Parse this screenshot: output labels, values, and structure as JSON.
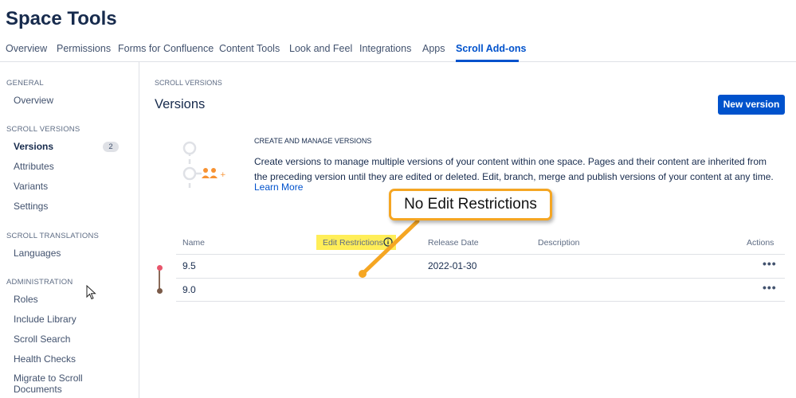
{
  "header": {
    "title": "Space Tools"
  },
  "tabs": [
    {
      "label": "Overview"
    },
    {
      "label": "Permissions"
    },
    {
      "label": "Forms for Confluence"
    },
    {
      "label": "Content Tools"
    },
    {
      "label": "Look and Feel"
    },
    {
      "label": "Integrations"
    },
    {
      "label": "Apps"
    },
    {
      "label": "Scroll Add-ons"
    }
  ],
  "sidebar": {
    "general_heading": "GENERAL",
    "overview": "Overview",
    "scroll_versions_heading": "SCROLL VERSIONS",
    "versions": "Versions",
    "versions_count": "2",
    "attributes": "Attributes",
    "variants": "Variants",
    "settings": "Settings",
    "scroll_translations_heading": "SCROLL TRANSLATIONS",
    "languages": "Languages",
    "administration_heading": "ADMINISTRATION",
    "roles": "Roles",
    "include_library": "Include Library",
    "scroll_search": "Scroll Search",
    "health_checks": "Health Checks",
    "migrate": "Migrate to Scroll Documents"
  },
  "main": {
    "breadcrumb": "SCROLL VERSIONS",
    "title": "Versions",
    "new_version_label": "New version",
    "info_heading": "CREATE AND MANAGE VERSIONS",
    "info_text": "Create versions to manage multiple versions of your content within one space. Pages and their content are inherited from the preceding version until they are edited or deleted. Edit, branch, merge and publish versions of your content at any time.",
    "learn_more": "Learn More"
  },
  "table": {
    "columns": {
      "name": "Name",
      "edit_restrictions": "Edit Restrictions",
      "release_date": "Release Date",
      "description": "Description",
      "actions": "Actions"
    },
    "rows": [
      {
        "name": "9.5",
        "release_date": "2022-01-30",
        "actions": "•••"
      },
      {
        "name": "9.0",
        "release_date": "",
        "actions": "•••"
      }
    ]
  },
  "annotation": {
    "callout_text": "No Edit Restrictions"
  },
  "colors": {
    "accent": "#0052cc",
    "highlight": "#ffee58",
    "callout_border": "#f5a623",
    "timeline_current": "#e8556b",
    "timeline_past": "#7a5a48"
  },
  "icons": [
    "info-icon",
    "more-actions-icon",
    "mouse-cursor-icon",
    "versions-illustration",
    "callout-arrow"
  ]
}
